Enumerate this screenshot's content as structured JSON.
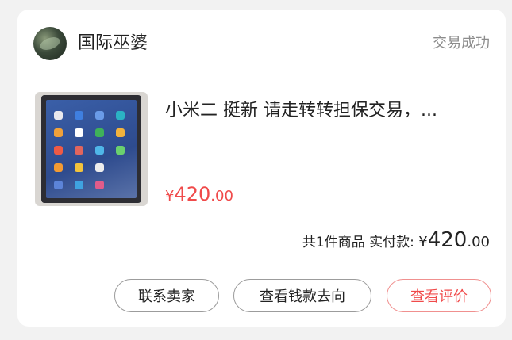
{
  "seller": {
    "name": "国际巫婆",
    "avatar_icon": "user-avatar"
  },
  "order": {
    "status": "交易成功",
    "item": {
      "title": "小米二 挺新 请走转转担保交易，...",
      "thumbnail_icon": "tablet-product-photo",
      "price_symbol": "¥",
      "price_integer": "420",
      "price_decimal": ".00"
    },
    "summary": {
      "label": "共1件商品 实付款: ",
      "price_symbol": "¥",
      "price_integer": "420",
      "price_decimal": ".00"
    }
  },
  "actions": {
    "contact_seller": "联系卖家",
    "view_money_flow": "查看钱款去向",
    "view_review": "查看评价"
  },
  "colors": {
    "accent_red": "#f04a4a",
    "review_border": "#f0908f",
    "status_gray": "#8c8c8c",
    "background": "#f2f2f2",
    "card": "#ffffff"
  }
}
